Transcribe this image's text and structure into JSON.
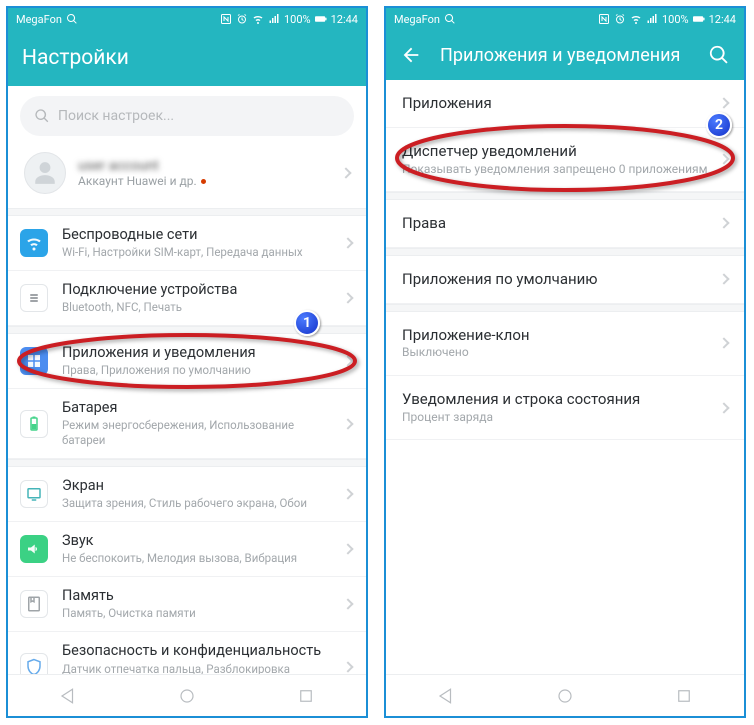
{
  "status": {
    "carrier": "MegaFon",
    "battery": "100%",
    "time": "12:44"
  },
  "left": {
    "title": "Настройки",
    "search_placeholder": "Поиск настроек...",
    "account": {
      "name": "user account",
      "sub": "Аккаунт Huawei и др."
    },
    "items": [
      {
        "id": "wireless",
        "title": "Беспроводные сети",
        "sub": "Wi-Fi, Настройки SIM-карт, Передача данных",
        "color": "#2ba4e8"
      },
      {
        "id": "devconn",
        "title": "Подключение устройства",
        "sub": "Bluetooth, NFC, Печать",
        "color": "#7a7f84"
      },
      {
        "id": "apps",
        "title": "Приложения и уведомления",
        "sub": "Права, Приложения по умолчанию",
        "color": "#4c8df0"
      },
      {
        "id": "battery",
        "title": "Батарея",
        "sub": "Режим энергосбережения, Использование батареи",
        "color": "#3bd184"
      },
      {
        "id": "display",
        "title": "Экран",
        "sub": "Защита зрения, Стиль рабочего экрана, Обои",
        "color": "#3bb0b5"
      },
      {
        "id": "sound",
        "title": "Звук",
        "sub": "Не беспокоить, Мелодия вызова, Вибрация",
        "color": "#3bd184"
      },
      {
        "id": "storage",
        "title": "Память",
        "sub": "Память, Очистка памяти",
        "color": "#9aa0a4"
      },
      {
        "id": "security",
        "title": "Безопасность и конфиденциальность",
        "sub": "Датчик отпечатка пальца, Разблокировка распознаванием лица, Блокировка экрана",
        "color": "#5fa7ea"
      }
    ]
  },
  "right": {
    "title": "Приложения и уведомления",
    "items": [
      {
        "id": "apps",
        "title": "Приложения",
        "sub": ""
      },
      {
        "id": "notif",
        "title": "Диспетчер уведомлений",
        "sub": "Показывать уведомления запрещено 0 приложениям"
      },
      {
        "id": "perms",
        "title": "Права",
        "sub": ""
      },
      {
        "id": "default",
        "title": "Приложения по умолчанию",
        "sub": ""
      },
      {
        "id": "clone",
        "title": "Приложение-клон",
        "sub": "Выключено"
      },
      {
        "id": "statusrow",
        "title": "Уведомления и строка состояния",
        "sub": "Процент заряда"
      }
    ]
  },
  "annotations": {
    "1": "1",
    "2": "2"
  }
}
